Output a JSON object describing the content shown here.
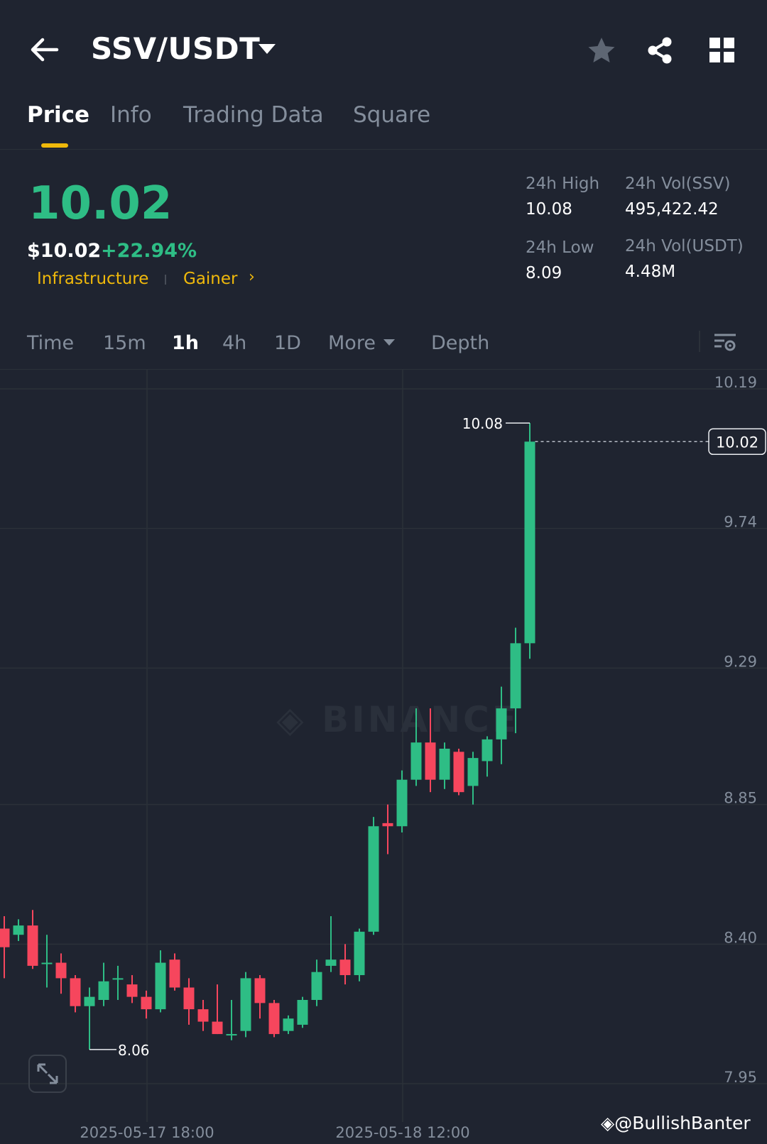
{
  "header": {
    "pair": "SSV/USDT",
    "icons": [
      "back-arrow-icon",
      "chevron-down-icon",
      "star-icon",
      "share-icon",
      "grid-icon"
    ]
  },
  "tabs": [
    {
      "label": "Price",
      "active": true
    },
    {
      "label": "Info",
      "active": false
    },
    {
      "label": "Trading Data",
      "active": false
    },
    {
      "label": "Square",
      "active": false
    }
  ],
  "ticker": {
    "price": "10.02",
    "price_usd": "$10.02",
    "change": "+22.94%",
    "tags": [
      "Infrastructure",
      "Gainer"
    ],
    "high_label": "24h High",
    "high_value": "10.08",
    "low_label": "24h Low",
    "low_value": "8.09",
    "vol_base_label": "24h Vol(SSV)",
    "vol_base_value": "495,422.42",
    "vol_quote_label": "24h Vol(USDT)",
    "vol_quote_value": "4.48M"
  },
  "toolbar": {
    "intervals": [
      "Time",
      "15m",
      "1h",
      "4h",
      "1D"
    ],
    "active_interval": "1h",
    "more_label": "More",
    "depth_label": "Depth"
  },
  "colors": {
    "up": "#2ebd85",
    "down": "#f6465d",
    "accent": "#f0b90b",
    "background": "#1f2430"
  },
  "chart_data": {
    "type": "candlestick",
    "y_ticks": [
      10.19,
      9.74,
      9.29,
      8.85,
      8.4,
      7.95
    ],
    "x_ticks": [
      "2025-05-17 18:00",
      "2025-05-18 12:00"
    ],
    "ylim": [
      7.95,
      10.19
    ],
    "last_price": "10.02",
    "high_marker": "10.08",
    "low_marker": "8.06",
    "watermark": "BINANCE",
    "candles": [
      {
        "o": 8.45,
        "c": 8.39,
        "h": 8.49,
        "l": 8.29
      },
      {
        "o": 8.43,
        "c": 8.46,
        "h": 8.48,
        "l": 8.41
      },
      {
        "o": 8.46,
        "c": 8.33,
        "h": 8.51,
        "l": 8.32
      },
      {
        "o": 8.34,
        "c": 8.34,
        "h": 8.43,
        "l": 8.26
      },
      {
        "o": 8.34,
        "c": 8.29,
        "h": 8.37,
        "l": 8.24
      },
      {
        "o": 8.29,
        "c": 8.2,
        "h": 8.3,
        "l": 8.18
      },
      {
        "o": 8.2,
        "c": 8.23,
        "h": 8.26,
        "l": 8.06
      },
      {
        "o": 8.22,
        "c": 8.28,
        "h": 8.34,
        "l": 8.2
      },
      {
        "o": 8.29,
        "c": 8.29,
        "h": 8.33,
        "l": 8.22
      },
      {
        "o": 8.27,
        "c": 8.23,
        "h": 8.3,
        "l": 8.21
      },
      {
        "o": 8.23,
        "c": 8.19,
        "h": 8.25,
        "l": 8.16
      },
      {
        "o": 8.19,
        "c": 8.34,
        "h": 8.38,
        "l": 8.18
      },
      {
        "o": 8.35,
        "c": 8.26,
        "h": 8.37,
        "l": 8.25
      },
      {
        "o": 8.26,
        "c": 8.19,
        "h": 8.29,
        "l": 8.14
      },
      {
        "o": 8.19,
        "c": 8.15,
        "h": 8.22,
        "l": 8.12
      },
      {
        "o": 8.15,
        "c": 8.11,
        "h": 8.27,
        "l": 8.11
      },
      {
        "o": 8.11,
        "c": 8.11,
        "h": 8.22,
        "l": 8.09
      },
      {
        "o": 8.12,
        "c": 8.29,
        "h": 8.31,
        "l": 8.1
      },
      {
        "o": 8.29,
        "c": 8.21,
        "h": 8.3,
        "l": 8.16
      },
      {
        "o": 8.21,
        "c": 8.11,
        "h": 8.22,
        "l": 8.1
      },
      {
        "o": 8.12,
        "c": 8.16,
        "h": 8.17,
        "l": 8.11
      },
      {
        "o": 8.14,
        "c": 8.22,
        "h": 8.23,
        "l": 8.13
      },
      {
        "o": 8.22,
        "c": 8.31,
        "h": 8.35,
        "l": 8.2
      },
      {
        "o": 8.33,
        "c": 8.35,
        "h": 8.49,
        "l": 8.31
      },
      {
        "o": 8.35,
        "c": 8.3,
        "h": 8.4,
        "l": 8.27
      },
      {
        "o": 8.3,
        "c": 8.44,
        "h": 8.45,
        "l": 8.28
      },
      {
        "o": 8.44,
        "c": 8.78,
        "h": 8.81,
        "l": 8.43
      },
      {
        "o": 8.79,
        "c": 8.78,
        "h": 8.85,
        "l": 8.69
      },
      {
        "o": 8.78,
        "c": 8.93,
        "h": 8.96,
        "l": 8.76
      },
      {
        "o": 8.93,
        "c": 9.05,
        "h": 9.16,
        "l": 8.91
      },
      {
        "o": 9.05,
        "c": 8.93,
        "h": 9.16,
        "l": 8.89
      },
      {
        "o": 8.93,
        "c": 9.03,
        "h": 9.05,
        "l": 8.9
      },
      {
        "o": 9.02,
        "c": 8.89,
        "h": 9.03,
        "l": 8.88
      },
      {
        "o": 8.91,
        "c": 9.0,
        "h": 9.02,
        "l": 8.85
      },
      {
        "o": 8.99,
        "c": 9.06,
        "h": 9.07,
        "l": 8.94
      },
      {
        "o": 9.06,
        "c": 9.16,
        "h": 9.23,
        "l": 8.98
      },
      {
        "o": 9.16,
        "c": 9.37,
        "h": 9.42,
        "l": 9.08
      },
      {
        "o": 9.37,
        "c": 10.02,
        "h": 10.08,
        "l": 9.32
      }
    ]
  }
}
